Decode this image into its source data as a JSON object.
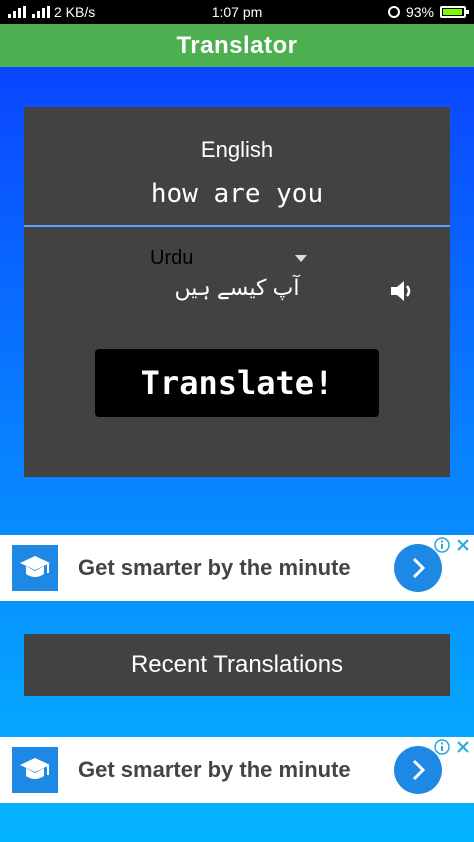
{
  "status_bar": {
    "network_speed": "2 KB/s",
    "time": "1:07 pm",
    "battery": "93%",
    "battery_level": 0.93
  },
  "app_bar": {
    "title": "Translator"
  },
  "translator": {
    "source_language": "English",
    "source_text": "how are you",
    "target_language": "Urdu",
    "translated_text": "آپ کیسے ہیں",
    "translate_label": "Translate!"
  },
  "ads": [
    {
      "headline": "Get smarter by the minute"
    },
    {
      "headline": "Get smarter by the minute"
    }
  ],
  "recent": {
    "label": "Recent Translations"
  },
  "colors": {
    "app_bar": "#4caf50",
    "card": "#424242",
    "accent": "#1e88e5"
  },
  "icons": [
    "signal-icon",
    "lock-icon",
    "battery-icon",
    "speaker-icon",
    "dropdown-arrow-icon",
    "graduation-cap-icon",
    "chevron-right-icon",
    "ad-info-icon",
    "close-icon"
  ]
}
